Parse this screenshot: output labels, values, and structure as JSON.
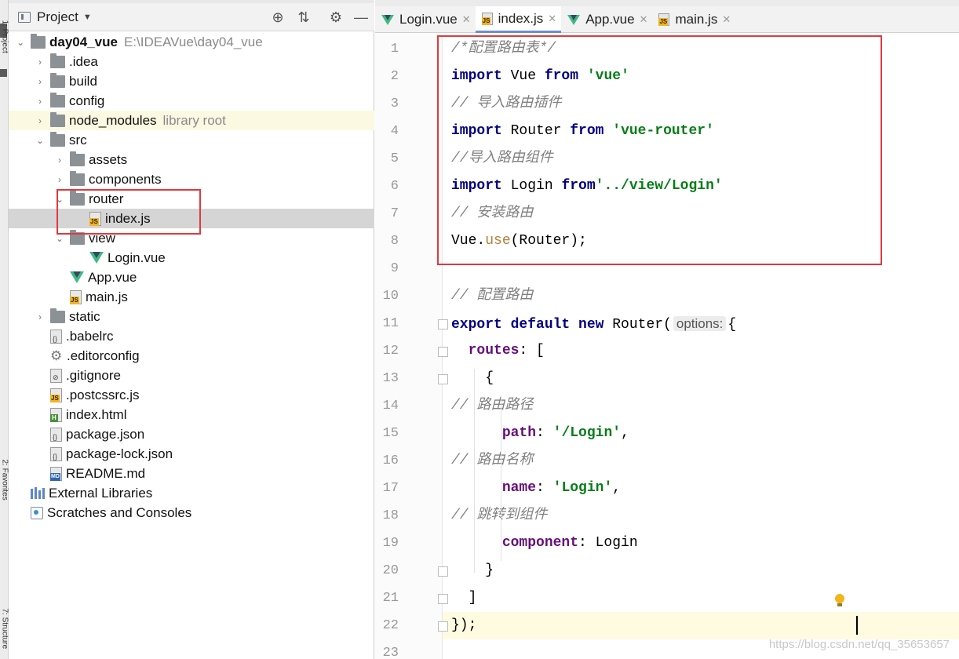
{
  "side_strip": {
    "project_label": "1: Project",
    "favorites_label": "2: Favorites",
    "structure_label": "7: Structure"
  },
  "project_panel": {
    "title": "Project",
    "tools": {
      "locate": "⊕",
      "collapse": "⇅",
      "settings": "⚙",
      "hide": "—"
    },
    "tree": [
      {
        "indent": 0,
        "arrow": "⌄",
        "icon": "folder",
        "name": "day04_vue",
        "hint": "E:\\IDEAVue\\day04_vue",
        "bold": true
      },
      {
        "indent": 1,
        "arrow": "›",
        "icon": "folder",
        "name": ".idea"
      },
      {
        "indent": 1,
        "arrow": "›",
        "icon": "folder",
        "name": "build"
      },
      {
        "indent": 1,
        "arrow": "›",
        "icon": "folder",
        "name": "config"
      },
      {
        "indent": 1,
        "arrow": "›",
        "icon": "folder",
        "name": "node_modules",
        "hint": "library root",
        "lib": true
      },
      {
        "indent": 1,
        "arrow": "⌄",
        "icon": "folder",
        "name": "src"
      },
      {
        "indent": 2,
        "arrow": "›",
        "icon": "folder",
        "name": "assets"
      },
      {
        "indent": 2,
        "arrow": "›",
        "icon": "folder",
        "name": "components"
      },
      {
        "indent": 2,
        "arrow": "⌄",
        "icon": "folder",
        "name": "router"
      },
      {
        "indent": 3,
        "arrow": "",
        "icon": "js",
        "name": "index.js",
        "selected": true
      },
      {
        "indent": 2,
        "arrow": "⌄",
        "icon": "folder",
        "name": "view"
      },
      {
        "indent": 3,
        "arrow": "",
        "icon": "vue",
        "name": "Login.vue"
      },
      {
        "indent": 2,
        "arrow": "",
        "icon": "vue",
        "name": "App.vue"
      },
      {
        "indent": 2,
        "arrow": "",
        "icon": "js",
        "name": "main.js"
      },
      {
        "indent": 1,
        "arrow": "›",
        "icon": "folder",
        "name": "static"
      },
      {
        "indent": 1,
        "arrow": "",
        "icon": "json",
        "name": ".babelrc"
      },
      {
        "indent": 1,
        "arrow": "",
        "icon": "gear",
        "name": ".editorconfig"
      },
      {
        "indent": 1,
        "arrow": "",
        "icon": "ignore",
        "name": ".gitignore"
      },
      {
        "indent": 1,
        "arrow": "",
        "icon": "js",
        "name": ".postcssrc.js"
      },
      {
        "indent": 1,
        "arrow": "",
        "icon": "html",
        "name": "index.html"
      },
      {
        "indent": 1,
        "arrow": "",
        "icon": "json",
        "name": "package.json"
      },
      {
        "indent": 1,
        "arrow": "",
        "icon": "json",
        "name": "package-lock.json"
      },
      {
        "indent": 1,
        "arrow": "",
        "icon": "md",
        "name": "README.md"
      },
      {
        "indent": 0,
        "arrow": "",
        "icon": "libs",
        "name": "External Libraries"
      },
      {
        "indent": 0,
        "arrow": "",
        "icon": "scratch",
        "name": "Scratches and Consoles"
      }
    ]
  },
  "editor": {
    "tabs": [
      {
        "name": "Login.vue",
        "icon": "vue"
      },
      {
        "name": "index.js",
        "icon": "js",
        "active": true
      },
      {
        "name": "App.vue",
        "icon": "vue"
      },
      {
        "name": "main.js",
        "icon": "js"
      }
    ],
    "line_numbers": [
      "1",
      "2",
      "3",
      "4",
      "5",
      "6",
      "7",
      "8",
      "9",
      "10",
      "11",
      "12",
      "13",
      "14",
      "15",
      "16",
      "17",
      "18",
      "19",
      "20",
      "21",
      "22",
      "23"
    ],
    "code_lines": [
      [
        {
          "t": "cm",
          "v": "/*配置路由表*/"
        }
      ],
      [
        {
          "t": "kw",
          "v": "import"
        },
        {
          "t": "plain",
          "v": " Vue "
        },
        {
          "t": "kw",
          "v": "from"
        },
        {
          "t": "plain",
          "v": " "
        },
        {
          "t": "str",
          "v": "'vue'"
        }
      ],
      [
        {
          "t": "cm",
          "v": "// 导入路由插件"
        }
      ],
      [
        {
          "t": "kw",
          "v": "import"
        },
        {
          "t": "plain",
          "v": " Router "
        },
        {
          "t": "kw",
          "v": "from"
        },
        {
          "t": "plain",
          "v": " "
        },
        {
          "t": "str",
          "v": "'vue-router'"
        }
      ],
      [
        {
          "t": "cm",
          "v": "//导入路由组件"
        }
      ],
      [
        {
          "t": "kw",
          "v": "import"
        },
        {
          "t": "plain",
          "v": " Login "
        },
        {
          "t": "kw",
          "v": "from"
        },
        {
          "t": "str",
          "v": "'../view/Login'"
        }
      ],
      [
        {
          "t": "cm",
          "v": "// 安装路由"
        }
      ],
      [
        {
          "t": "plain",
          "v": "Vue."
        },
        {
          "t": "fn",
          "v": "use"
        },
        {
          "t": "plain",
          "v": "(Router);"
        }
      ],
      [],
      [
        {
          "t": "cm",
          "v": "// 配置路由"
        }
      ],
      [
        {
          "t": "kw",
          "v": "export default new"
        },
        {
          "t": "plain",
          "v": " Router("
        },
        {
          "t": "chip",
          "v": "options:"
        },
        {
          "t": "plain",
          "v": "{"
        }
      ],
      [
        {
          "t": "plain",
          "v": "  "
        },
        {
          "t": "prop",
          "v": "routes"
        },
        {
          "t": "plain",
          "v": ": ["
        }
      ],
      [
        {
          "t": "plain",
          "v": "    {"
        }
      ],
      [
        {
          "t": "cm",
          "v": "// 路由路径"
        }
      ],
      [
        {
          "t": "plain",
          "v": "      "
        },
        {
          "t": "prop",
          "v": "path"
        },
        {
          "t": "plain",
          "v": ": "
        },
        {
          "t": "str",
          "v": "'/Login'"
        },
        {
          "t": "plain",
          "v": ","
        }
      ],
      [
        {
          "t": "cm",
          "v": "// 路由名称"
        }
      ],
      [
        {
          "t": "plain",
          "v": "      "
        },
        {
          "t": "prop",
          "v": "name"
        },
        {
          "t": "plain",
          "v": ": "
        },
        {
          "t": "str",
          "v": "'Login'"
        },
        {
          "t": "plain",
          "v": ","
        }
      ],
      [
        {
          "t": "cm",
          "v": "// 跳转到组件"
        }
      ],
      [
        {
          "t": "plain",
          "v": "      "
        },
        {
          "t": "prop",
          "v": "component"
        },
        {
          "t": "plain",
          "v": ": Login"
        }
      ],
      [
        {
          "t": "plain",
          "v": "    }"
        }
      ],
      [
        {
          "t": "plain",
          "v": "  ]"
        }
      ],
      [
        {
          "t": "plain",
          "v": "});"
        }
      ],
      []
    ]
  },
  "watermark": "https://blog.csdn.net/qq_35653657"
}
